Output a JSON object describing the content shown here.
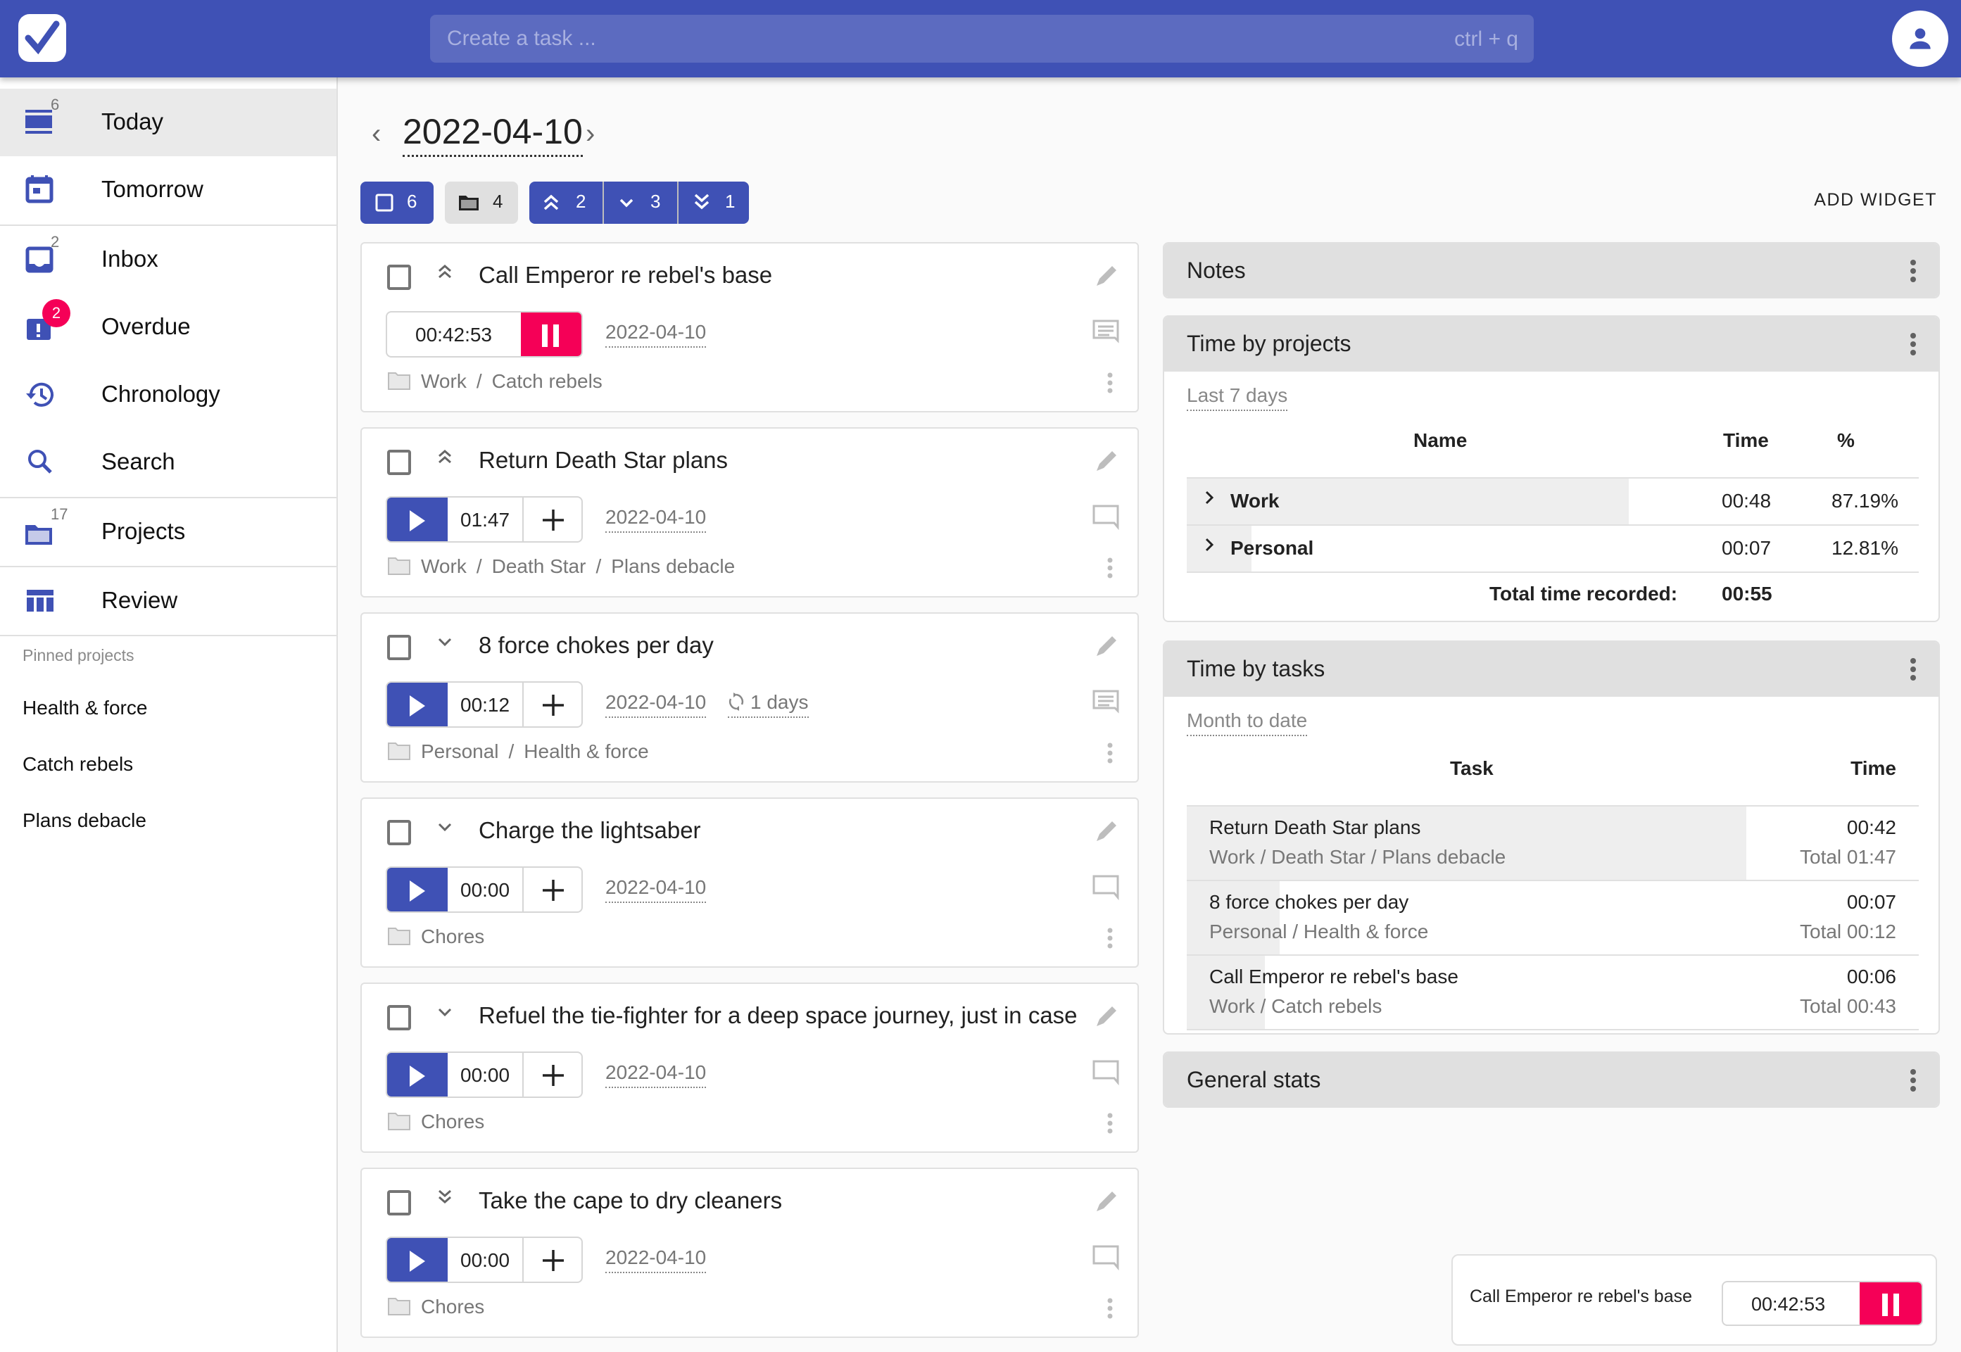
{
  "header": {
    "search_placeholder": "Create a task ...",
    "shortcut": "ctrl + q",
    "brand_color": "#3f51b5",
    "accent_color": "#f50057"
  },
  "sidebar": {
    "items": [
      {
        "label": "Today",
        "count": "6",
        "icon": "today-icon",
        "active": true
      },
      {
        "label": "Tomorrow",
        "icon": "calendar-icon"
      },
      {
        "label": "Inbox",
        "count": "2",
        "icon": "inbox-icon"
      },
      {
        "label": "Overdue",
        "badge": "2",
        "icon": "overdue-icon"
      },
      {
        "label": "Chronology",
        "icon": "history-icon"
      },
      {
        "label": "Search",
        "icon": "search-icon"
      },
      {
        "label": "Projects",
        "count": "17",
        "icon": "folder-icon"
      },
      {
        "label": "Review",
        "icon": "review-icon"
      }
    ],
    "pinned_title": "Pinned projects",
    "pinned": [
      "Health & force",
      "Catch rebels",
      "Plans debacle"
    ]
  },
  "main": {
    "date": "2022-04-10",
    "filters": {
      "tasks": "6",
      "projects": "4",
      "high": "2",
      "low": "3",
      "lowest": "1"
    },
    "add_widget": "ADD WIDGET",
    "tasks": [
      {
        "title": "Call Emperor re rebel's base",
        "priority": "high",
        "timer": "00:42:53",
        "running": true,
        "due": "2022-04-10",
        "path": [
          "Work",
          "Catch rebels"
        ],
        "has_notes": true
      },
      {
        "title": "Return Death Star plans",
        "priority": "high",
        "timer": "01:47",
        "running": false,
        "due": "2022-04-10",
        "path": [
          "Work",
          "Death Star",
          "Plans debacle"
        ],
        "has_notes": false
      },
      {
        "title": "8 force chokes per day",
        "priority": "low",
        "timer": "00:12",
        "running": false,
        "due": "2022-04-10",
        "repeat": "1 days",
        "path": [
          "Personal",
          "Health & force"
        ],
        "has_notes": true
      },
      {
        "title": "Charge the lightsaber",
        "priority": "low",
        "timer": "00:00",
        "running": false,
        "due": "2022-04-10",
        "path": [
          "Chores"
        ],
        "has_notes": false
      },
      {
        "title": "Refuel the tie-fighter for a deep space journey, just in case",
        "priority": "low",
        "timer": "00:00",
        "running": false,
        "due": "2022-04-10",
        "path": [
          "Chores"
        ],
        "has_notes": false
      },
      {
        "title": "Take the cape to dry cleaners",
        "priority": "lowest",
        "timer": "00:00",
        "running": false,
        "due": "2022-04-10",
        "path": [
          "Chores"
        ],
        "has_notes": false
      }
    ]
  },
  "widgets": {
    "notes": {
      "title": "Notes"
    },
    "time_by_projects": {
      "title": "Time by projects",
      "range": "Last 7 days",
      "headers": {
        "name": "Name",
        "time": "Time",
        "pct": "%"
      },
      "rows": [
        {
          "name": "Work",
          "time": "00:48",
          "pct": "87.19%",
          "share": 0.8719
        },
        {
          "name": "Personal",
          "time": "00:07",
          "pct": "12.81%",
          "share": 0.1281
        }
      ],
      "total_label": "Total time recorded:",
      "total": "00:55"
    },
    "time_by_tasks": {
      "title": "Time by tasks",
      "range": "Month to date",
      "headers": {
        "task": "Task",
        "time": "Time"
      },
      "rows": [
        {
          "task": "Return Death Star plans",
          "path": "Work / Death Star / Plans debacle",
          "time": "00:42",
          "total": "Total 01:47",
          "share": 0.764
        },
        {
          "task": "8 force chokes per day",
          "path": "Personal / Health & force",
          "time": "00:07",
          "total": "Total 00:12",
          "share": 0.127
        },
        {
          "task": "Call Emperor re rebel's base",
          "path": "Work / Catch rebels",
          "time": "00:06",
          "total": "Total 00:43",
          "share": 0.107
        }
      ]
    },
    "general_stats": {
      "title": "General stats"
    }
  },
  "running_timer": {
    "task": "Call Emperor re rebel's base",
    "time": "00:42:53"
  }
}
